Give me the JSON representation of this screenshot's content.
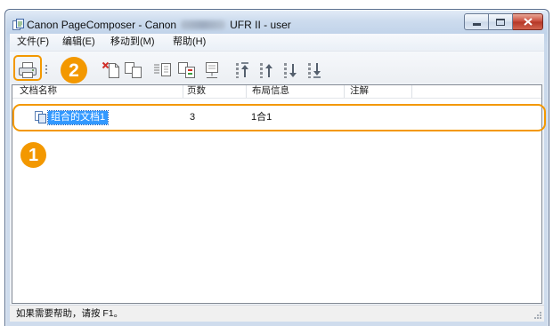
{
  "window": {
    "title_prefix": "Canon PageComposer - Canon",
    "title_suffix": "UFR II - user",
    "app_icon": "pagecomposer-app-icon",
    "controls": {
      "minimize_icon": "minimize-icon",
      "maximize_icon": "maximize-icon",
      "close_icon": "close-icon"
    }
  },
  "menu": [
    {
      "label": "文件(F)"
    },
    {
      "label": "编辑(E)"
    },
    {
      "label": "移动到(M)"
    },
    {
      "label": "帮助(H)"
    }
  ],
  "toolbar": {
    "buttons": [
      {
        "icon": "printer-icon"
      },
      {
        "icon": "delete-document-icon"
      },
      {
        "icon": "duplicate-document-icon"
      },
      {
        "icon": "combine-documents-icon"
      },
      {
        "icon": "split-document-icon"
      },
      {
        "icon": "preview-icon"
      },
      {
        "icon": "move-to-top-icon"
      },
      {
        "icon": "move-up-icon"
      },
      {
        "icon": "move-down-icon"
      },
      {
        "icon": "move-to-bottom-icon"
      }
    ]
  },
  "callouts": {
    "print_button": "2",
    "document_row": "1"
  },
  "list": {
    "columns": [
      {
        "label": "文档名称"
      },
      {
        "label": "页数"
      },
      {
        "label": "布局信息"
      },
      {
        "label": "注解"
      }
    ],
    "rows": [
      {
        "icon": "combined-document-icon",
        "name": "组合的文档1",
        "pages": "3",
        "layout": "1合1",
        "notes": "",
        "selected": true
      }
    ]
  },
  "statusbar": {
    "text": "如果需要帮助，请按 F1。",
    "grip_icon": "resize-grip-icon"
  },
  "colors": {
    "callout_orange": "#f39800",
    "selection_blue": "#3399ff",
    "close_button_red": "#c84a3a"
  }
}
